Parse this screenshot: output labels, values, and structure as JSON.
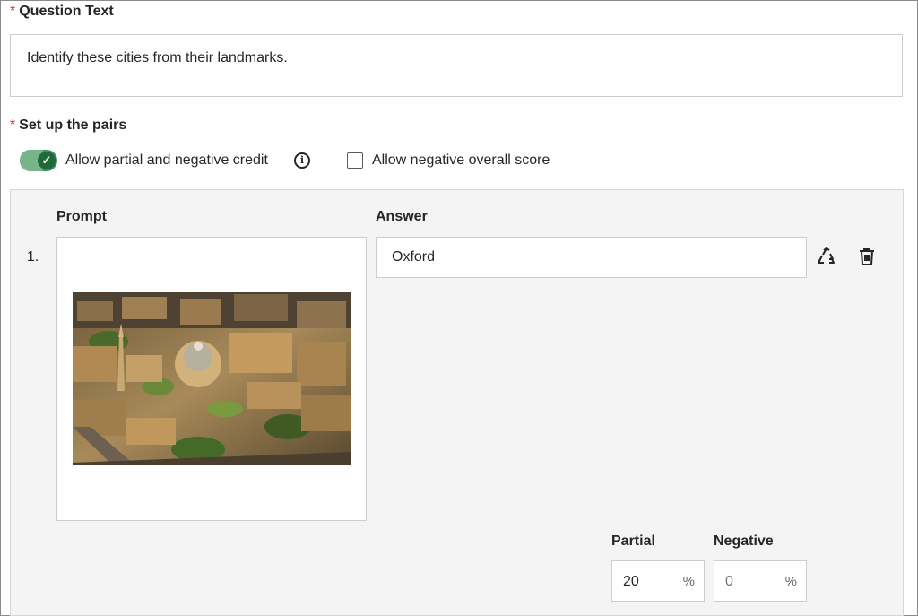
{
  "question_text": {
    "required_marker": "*",
    "label": "Question Text",
    "value": "Identify these cities from their landmarks."
  },
  "pairs": {
    "required_marker": "*",
    "label": "Set up the pairs",
    "partial_credit_toggle": {
      "label": "Allow partial and negative credit",
      "checked": true
    },
    "negative_overall_checkbox": {
      "label": "Allow negative overall score",
      "checked": false
    },
    "columns": {
      "prompt": "Prompt",
      "answer": "Answer"
    },
    "rows": [
      {
        "number": "1.",
        "prompt_image": "aerial photo of Oxford",
        "answer": "Oxford"
      }
    ],
    "partial": {
      "label": "Partial",
      "value": "20",
      "unit": "%"
    },
    "negative": {
      "label": "Negative",
      "placeholder": "0",
      "unit": "%"
    }
  },
  "icons": {
    "info": "info-icon",
    "recycle": "recycle-icon",
    "delete": "trash-icon",
    "check": "check-icon"
  },
  "colors": {
    "toggle_on": "#3f8f5a",
    "required_star": "#c0392b"
  }
}
